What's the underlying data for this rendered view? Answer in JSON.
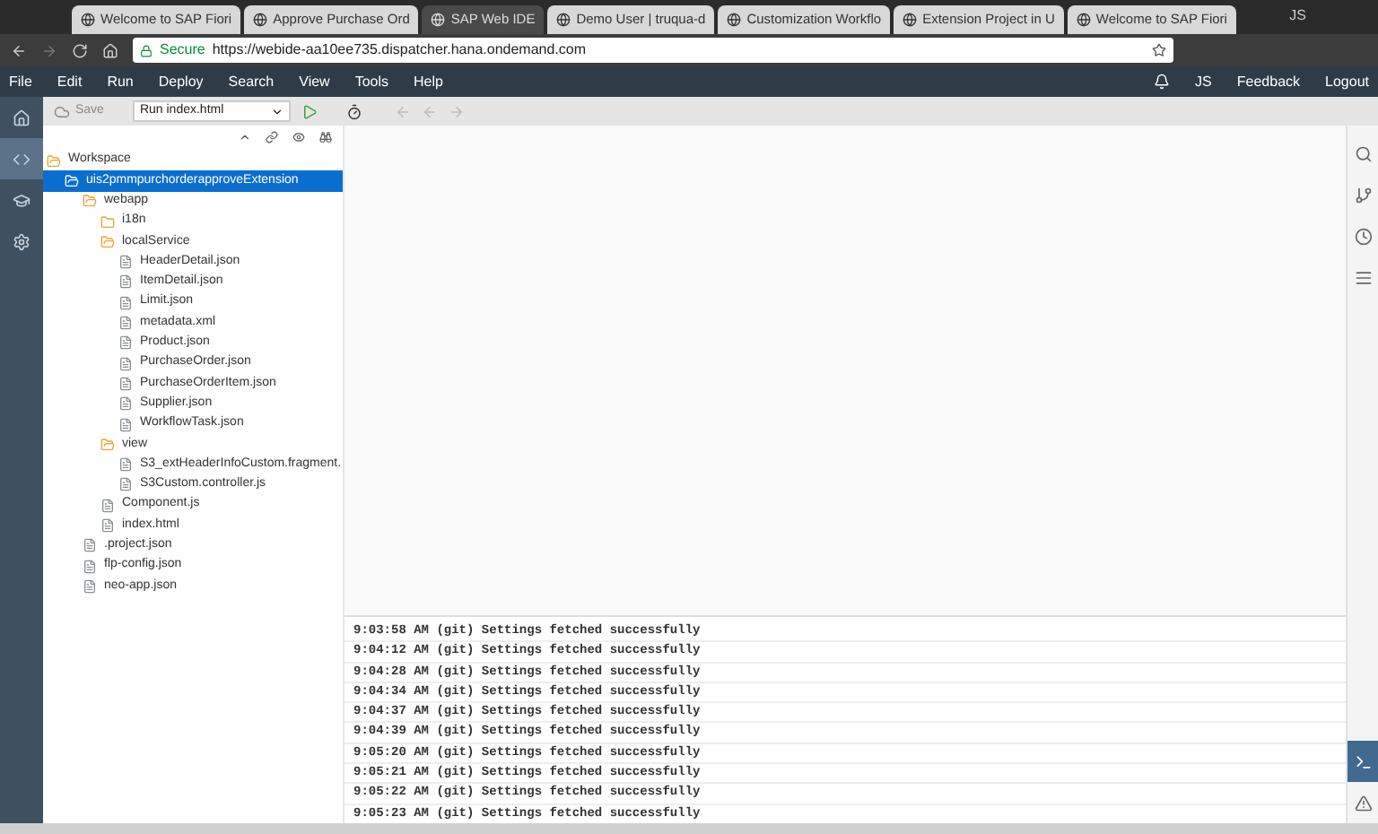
{
  "browser": {
    "tabs": [
      {
        "title": "Welcome to SAP Fiori",
        "selected": false
      },
      {
        "title": "Approve Purchase Ord",
        "selected": false
      },
      {
        "title": "SAP Web IDE",
        "selected": true
      },
      {
        "title": "Demo User | truqua-d",
        "selected": false
      },
      {
        "title": "Customization Workflo",
        "selected": false
      },
      {
        "title": "Extension Project in U",
        "selected": false
      },
      {
        "title": "Welcome to SAP Fiori",
        "selected": false
      }
    ],
    "profile": "JS",
    "secure": "Secure",
    "url": "https://webide-aa10ee735.dispatcher.hana.ondemand.com"
  },
  "menu_bar": {
    "items": [
      "File",
      "Edit",
      "Run",
      "Deploy",
      "Search",
      "View",
      "Tools",
      "Help"
    ],
    "user": "JS",
    "feedback": "Feedback",
    "logout": "Logout"
  },
  "toolbar": {
    "save": "Save",
    "run_config": "Run index.html"
  },
  "left_rail": [
    {
      "kind": "home",
      "selected": false
    },
    {
      "kind": "code",
      "selected": true
    },
    {
      "kind": "learn",
      "selected": false
    },
    {
      "kind": "settings",
      "selected": false
    }
  ],
  "tree": [
    {
      "name": "Workspace",
      "kind": "folder",
      "selected": false,
      "children": [
        {
          "name": "uis2pmmpurchorderapproveExtension",
          "kind": "project",
          "selected": true,
          "children": [
            {
              "name": "webapp",
              "kind": "folder",
              "selected": false,
              "children": [
                {
                  "name": "i18n",
                  "kind": "closed-folder",
                  "selected": false
                },
                {
                  "name": "localService",
                  "kind": "folder",
                  "selected": false,
                  "children": [
                    {
                      "name": "HeaderDetail.json",
                      "kind": "file",
                      "selected": false
                    },
                    {
                      "name": "ItemDetail.json",
                      "kind": "file",
                      "selected": false
                    },
                    {
                      "name": "Limit.json",
                      "kind": "file",
                      "selected": false
                    },
                    {
                      "name": "metadata.xml",
                      "kind": "file",
                      "selected": false
                    },
                    {
                      "name": "Product.json",
                      "kind": "file",
                      "selected": false
                    },
                    {
                      "name": "PurchaseOrder.json",
                      "kind": "file",
                      "selected": false
                    },
                    {
                      "name": "PurchaseOrderItem.json",
                      "kind": "file",
                      "selected": false
                    },
                    {
                      "name": "Supplier.json",
                      "kind": "file",
                      "selected": false
                    },
                    {
                      "name": "WorkflowTask.json",
                      "kind": "file",
                      "selected": false
                    }
                  ]
                },
                {
                  "name": "view",
                  "kind": "folder",
                  "selected": false,
                  "children": [
                    {
                      "name": "S3_extHeaderInfoCustom.fragment.",
                      "kind": "file",
                      "selected": false
                    },
                    {
                      "name": "S3Custom.controller.js",
                      "kind": "file",
                      "selected": false
                    }
                  ]
                },
                {
                  "name": "Component.js",
                  "kind": "file",
                  "selected": false
                },
                {
                  "name": "index.html",
                  "kind": "file",
                  "selected": false
                }
              ]
            },
            {
              "name": ".project.json",
              "kind": "file",
              "selected": false
            },
            {
              "name": "flp-config.json",
              "kind": "file",
              "selected": false
            },
            {
              "name": "neo-app.json",
              "kind": "file",
              "selected": false
            }
          ]
        }
      ]
    }
  ],
  "console": [
    "9:03:58 AM (git) Settings fetched successfully",
    "9:04:12 AM (git) Settings fetched successfully",
    "9:04:28 AM (git) Settings fetched successfully",
    "9:04:34 AM (git) Settings fetched successfully",
    "9:04:37 AM (git) Settings fetched successfully",
    "9:04:39 AM (git) Settings fetched successfully",
    "9:05:20 AM (git) Settings fetched successfully",
    "9:05:21 AM (git) Settings fetched successfully",
    "9:05:22 AM (git) Settings fetched successfully",
    "9:05:23 AM (git) Settings fetched successfully"
  ],
  "right_rail": [
    {
      "kind": "search",
      "selected": false
    },
    {
      "kind": "git",
      "selected": false
    },
    {
      "kind": "history",
      "selected": false
    },
    {
      "kind": "outline",
      "selected": false
    },
    {
      "kind": "console",
      "selected": true
    },
    {
      "kind": "warning",
      "selected": false
    }
  ]
}
